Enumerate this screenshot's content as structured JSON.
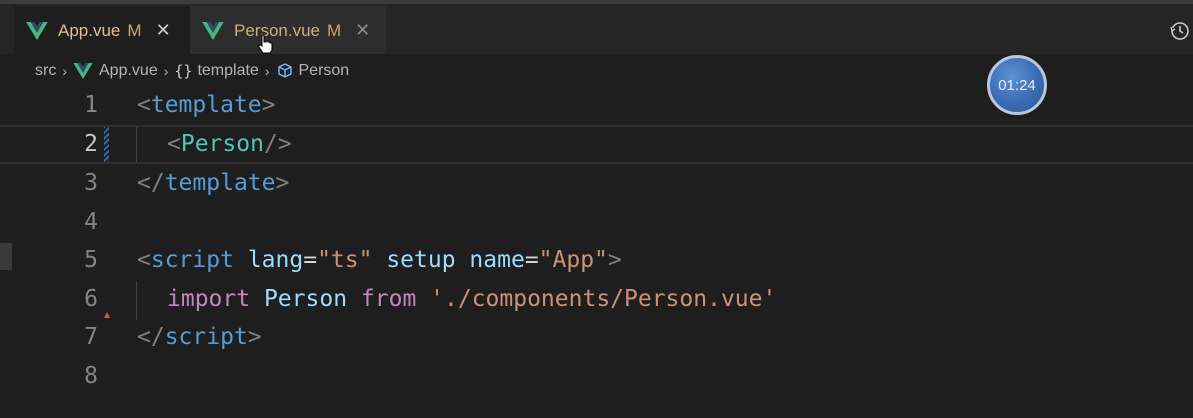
{
  "tabs": [
    {
      "label": "App.vue",
      "modified": "M",
      "close": "✕",
      "icon": "vue-logo-icon",
      "active": true
    },
    {
      "label": "Person.vue",
      "modified": "M",
      "close": "✕",
      "icon": "vue-logo-icon",
      "active": false
    }
  ],
  "breadcrumb": {
    "items": [
      {
        "label": "src"
      },
      {
        "label": "App.vue",
        "icon": "vue-logo-icon"
      },
      {
        "label": "template",
        "icon": "braces-icon",
        "glyph": "{}"
      },
      {
        "label": "Person",
        "icon": "component-cube-icon"
      }
    ],
    "separator": "›"
  },
  "timer": {
    "label": "01:24"
  },
  "editor": {
    "lines": [
      {
        "number": "1"
      },
      {
        "number": "2"
      },
      {
        "number": "3"
      },
      {
        "number": "4"
      },
      {
        "number": "5"
      },
      {
        "number": "6"
      },
      {
        "number": "7"
      },
      {
        "number": "8"
      }
    ],
    "active_line": "2",
    "tokens": {
      "l1_open": "<",
      "l1_tag": "template",
      "l1_close": ">",
      "l2_open": "<",
      "l2_comp": "Person",
      "l2_close": "/>",
      "l3_open": "</",
      "l3_tag": "template",
      "l3_close": ">",
      "l5_open": "<",
      "l5_tag": "script",
      "l5_attr1": "lang",
      "l5_eq1": "=",
      "l5_val1": "\"ts\"",
      "l5_attr2": "setup",
      "l5_attr3": "name",
      "l5_eq3": "=",
      "l5_val3": "\"App\"",
      "l5_close": ">",
      "l6_import": "import",
      "l6_ident": "Person",
      "l6_from": "from",
      "l6_path": "'./components/Person.vue'",
      "l7_open": "</",
      "l7_tag": "script",
      "l7_close": ">"
    }
  },
  "colors": {
    "editor_bg": "#1e1e1e",
    "tag": "#569cd6",
    "component": "#4ec9b0",
    "attribute": "#9cdcfe",
    "string": "#ce9178",
    "keyword": "#c586c0",
    "modified_tab": "#e2c08d",
    "vue_green": "#41b883"
  }
}
